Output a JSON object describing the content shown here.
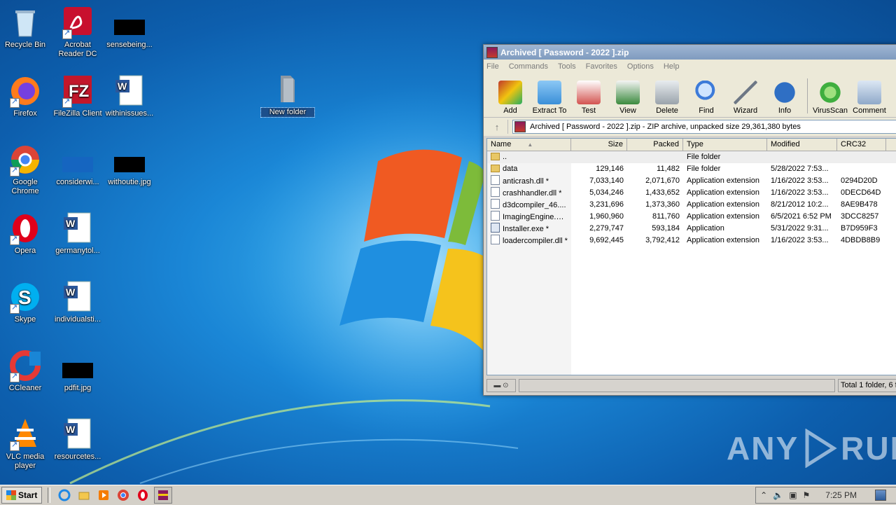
{
  "desktop": {
    "icons": [
      {
        "label": "Recycle Bin",
        "icon": "recycle-bin-icon"
      },
      {
        "label": "Acrobat Reader DC",
        "icon": "acrobat-icon"
      },
      {
        "label": "sensebeing...",
        "icon": "image-file-icon"
      },
      {
        "label": "Firefox",
        "icon": "firefox-icon"
      },
      {
        "label": "FileZilla Client",
        "icon": "filezilla-icon"
      },
      {
        "label": "withinissues...",
        "icon": "word-doc-icon"
      },
      {
        "label": "New folder",
        "icon": "folder-icon"
      },
      {
        "label": "Google Chrome",
        "icon": "chrome-icon"
      },
      {
        "label": "considerwi...",
        "icon": "image-file-icon"
      },
      {
        "label": "withoutie.jpg",
        "icon": "image-file-icon"
      },
      {
        "label": "Opera",
        "icon": "opera-icon"
      },
      {
        "label": "germanytol...",
        "icon": "word-doc-icon"
      },
      {
        "label": "Skype",
        "icon": "skype-icon"
      },
      {
        "label": "individualsti...",
        "icon": "word-doc-icon"
      },
      {
        "label": "CCleaner",
        "icon": "ccleaner-icon"
      },
      {
        "label": "pdfit.jpg",
        "icon": "image-file-icon"
      },
      {
        "label": "VLC media player",
        "icon": "vlc-icon"
      },
      {
        "label": "resourcetes...",
        "icon": "word-doc-icon"
      }
    ]
  },
  "window": {
    "title": "Archived [ Password - 2022 ].zip",
    "menu": [
      "File",
      "Commands",
      "Tools",
      "Favorites",
      "Options",
      "Help"
    ],
    "toolbar": [
      {
        "label": "Add",
        "color": "#c0392b"
      },
      {
        "label": "Extract To",
        "color": "#3a8fd8"
      },
      {
        "label": "Test",
        "color": "#d35450"
      },
      {
        "label": "View",
        "color": "#3b8a3e"
      },
      {
        "label": "Delete",
        "color": "#9aa3ab"
      },
      {
        "label": "Find",
        "color": "#3d7bd9"
      },
      {
        "label": "Wizard",
        "color": "#b0b8c2"
      },
      {
        "label": "Info",
        "color": "#2f6fc4"
      },
      {
        "label": "VirusScan",
        "color": "#3fae3f"
      },
      {
        "label": "Comment",
        "color": "#8fa9c9"
      }
    ],
    "address": "Archived [ Password - 2022 ].zip - ZIP archive, unpacked size 29,361,380 bytes",
    "columns": {
      "name": "Name",
      "size": "Size",
      "packed": "Packed",
      "type": "Type",
      "modified": "Modified",
      "crc": "CRC32"
    },
    "files": [
      {
        "name": "..",
        "size": "",
        "packed": "",
        "type": "File folder",
        "modified": "",
        "crc": "",
        "kind": "folder"
      },
      {
        "name": "data",
        "size": "129,146",
        "packed": "11,482",
        "type": "File folder",
        "modified": "5/28/2022 7:53...",
        "crc": "",
        "kind": "folder"
      },
      {
        "name": "anticrash.dll *",
        "size": "7,033,140",
        "packed": "2,071,670",
        "type": "Application extension",
        "modified": "1/16/2022 3:53...",
        "crc": "0294D20D",
        "kind": "dll"
      },
      {
        "name": "crashhandler.dll *",
        "size": "5,034,246",
        "packed": "1,433,652",
        "type": "Application extension",
        "modified": "1/16/2022 3:53...",
        "crc": "0DECD64D",
        "kind": "dll"
      },
      {
        "name": "d3dcompiler_46....",
        "size": "3,231,696",
        "packed": "1,373,360",
        "type": "Application extension",
        "modified": "8/21/2012 10:2...",
        "crc": "8AE9B478",
        "kind": "dll"
      },
      {
        "name": "ImagingEngine.dll *",
        "size": "1,960,960",
        "packed": "811,760",
        "type": "Application extension",
        "modified": "6/5/2021 6:52 PM",
        "crc": "3DCC8257",
        "kind": "dll"
      },
      {
        "name": "Installer.exe *",
        "size": "2,279,747",
        "packed": "593,184",
        "type": "Application",
        "modified": "5/31/2022 9:31...",
        "crc": "B7D959F3",
        "kind": "exe"
      },
      {
        "name": "loadercompiler.dll *",
        "size": "9,692,445",
        "packed": "3,792,412",
        "type": "Application extension",
        "modified": "1/16/2022 3:53...",
        "crc": "4DBDB8B9",
        "kind": "dll"
      }
    ],
    "status": "Total 1 folder, 6 fi"
  },
  "watermark": {
    "left": "ANY",
    "right": "RUN"
  },
  "taskbar": {
    "start_label": "Start",
    "quick": [
      "ie-icon",
      "explorer-icon",
      "media-player-icon",
      "chrome-icon",
      "opera-icon",
      "winrar-icon"
    ],
    "clock": "7:25 PM"
  }
}
